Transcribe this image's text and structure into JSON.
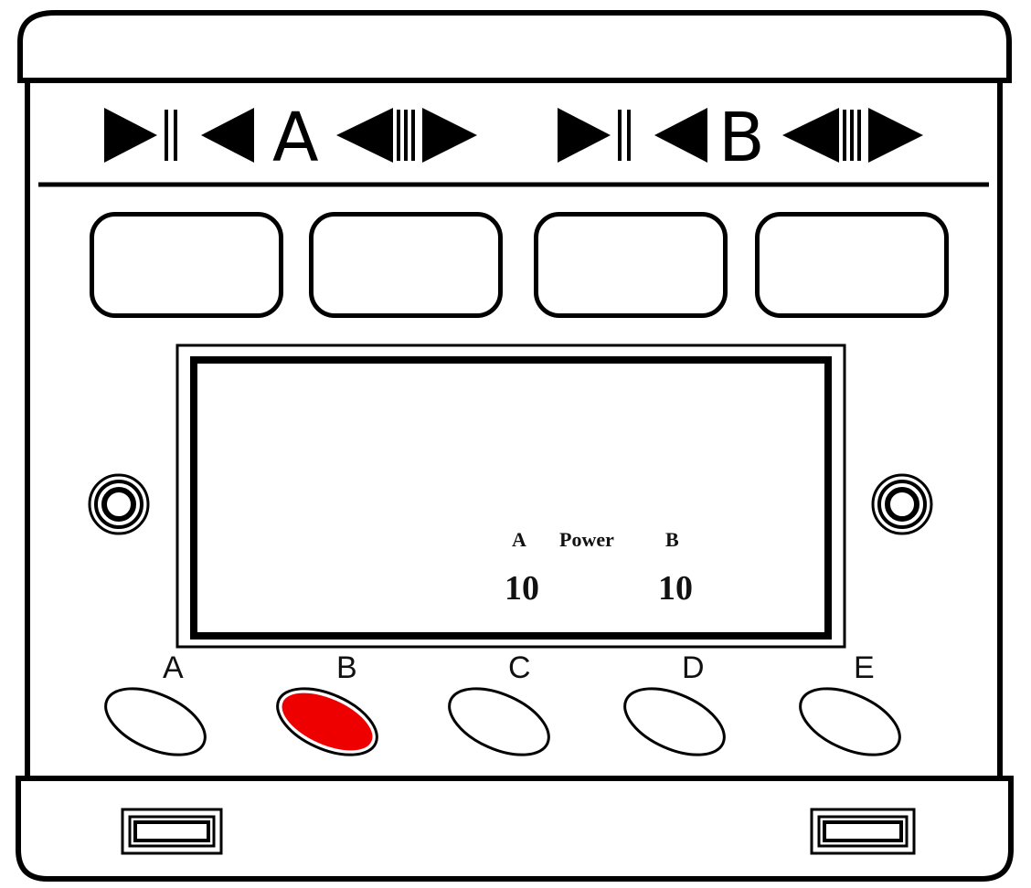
{
  "channel_bar": {
    "channel_a_label": "A",
    "channel_b_label": "B"
  },
  "lcd": {
    "left_label": "A",
    "center_label": "Power",
    "right_label": "B",
    "value_a": "10",
    "value_b": "10"
  },
  "mode_buttons": [
    {
      "label": "A",
      "active": false
    },
    {
      "label": "B",
      "active": true
    },
    {
      "label": "C",
      "active": false
    },
    {
      "label": "D",
      "active": false
    },
    {
      "label": "E",
      "active": false
    }
  ],
  "colors": {
    "active_button": "#ee0000",
    "outline": "#000000",
    "background": "#ffffff"
  },
  "icons": [
    "transport-arrows-icon",
    "knob-icon",
    "slot-icon"
  ]
}
